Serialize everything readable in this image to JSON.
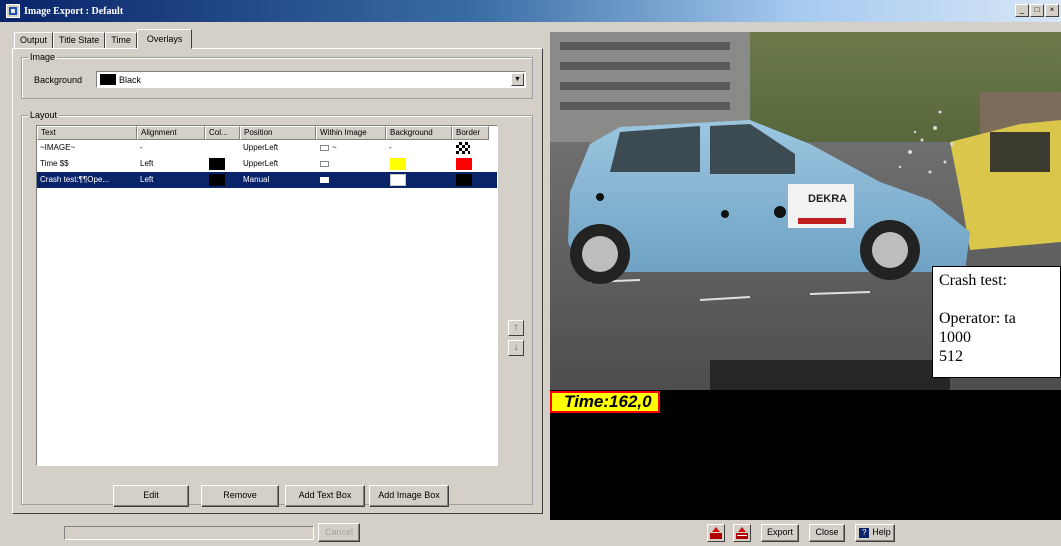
{
  "window": {
    "title": "Image Export : Default",
    "controls": [
      "_",
      "□",
      "×"
    ]
  },
  "tabs": [
    "Output",
    "Title State",
    "Time",
    "Overlays"
  ],
  "active_tab": "Overlays",
  "image_group": {
    "legend": "Image",
    "background_label": "Background",
    "background_value": "Black",
    "background_color": "#000000"
  },
  "layout_group": {
    "legend": "Layout",
    "columns": [
      "Text",
      "Alignment",
      "Col...",
      "Position",
      "Within Image",
      "Background",
      "Border"
    ],
    "rows": [
      {
        "text": "~IMAGE~",
        "alignment": "-",
        "color": "",
        "position": "UpperLeft",
        "within": "~",
        "background": "-",
        "border": "checker"
      },
      {
        "text": "Time $$",
        "alignment": "Left",
        "color": "black",
        "position": "UpperLeft",
        "within": "",
        "background": "yellow",
        "border": "red"
      },
      {
        "text": "Crash test:¶¶Ope...",
        "alignment": "Left",
        "color": "black",
        "position": "Manual",
        "within": "",
        "background": "white",
        "border": "black"
      }
    ],
    "selected_row": 2
  },
  "buttons": {
    "edit": "Edit",
    "remove": "Remove",
    "add_text_box": "Add Text Box",
    "add_image_box": "Add Image Box",
    "cancel": "Cancel",
    "export": "Export",
    "close": "Close",
    "help": "Help",
    "move_up": "↑",
    "move_down": "↓"
  },
  "progress": 0,
  "preview": {
    "text_box_lines": [
      "Crash test:",
      "",
      "Operator: ta",
      "1000",
      "512"
    ],
    "time_overlay": "Time:162,0",
    "dekra_label": "DEKRA"
  },
  "colors": {
    "selection": "#0a246a",
    "face": "#d4d0c8",
    "time_bg": "#ffff00",
    "time_border": "#ff0000"
  }
}
